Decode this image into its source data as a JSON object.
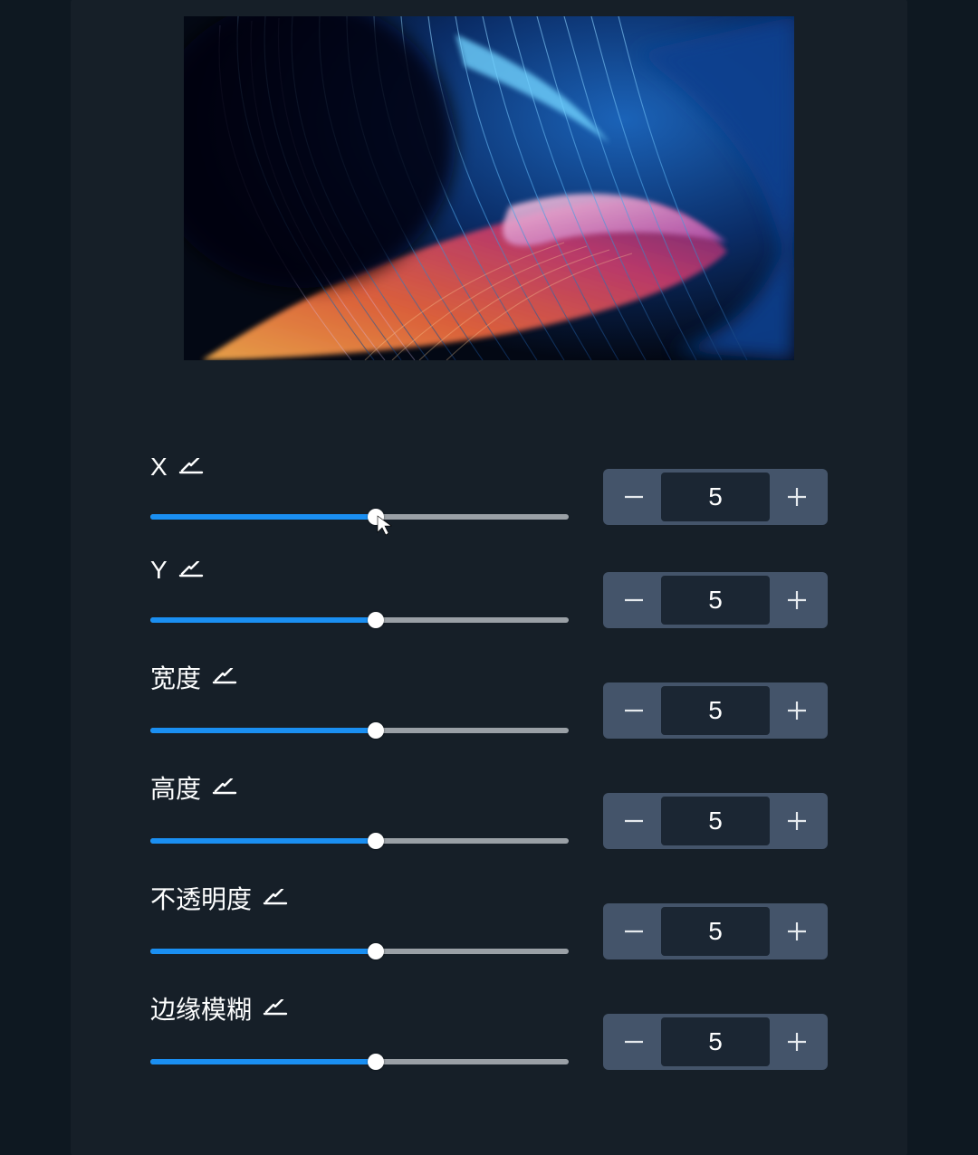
{
  "controls": [
    {
      "id": "x",
      "label": "X",
      "value": 5,
      "percent": 54,
      "has_cursor": true
    },
    {
      "id": "y",
      "label": "Y",
      "value": 5,
      "percent": 54,
      "has_cursor": false
    },
    {
      "id": "width",
      "label": "宽度",
      "value": 5,
      "percent": 54,
      "has_cursor": false
    },
    {
      "id": "height",
      "label": "高度",
      "value": 5,
      "percent": 54,
      "has_cursor": false
    },
    {
      "id": "opacity",
      "label": "不透明度",
      "value": 5,
      "percent": 54,
      "has_cursor": false
    },
    {
      "id": "edge-blur",
      "label": "边缘模糊",
      "value": 5,
      "percent": 54,
      "has_cursor": false
    }
  ],
  "icons": {
    "reset": "reset-icon",
    "minus": "−",
    "plus": "+"
  }
}
